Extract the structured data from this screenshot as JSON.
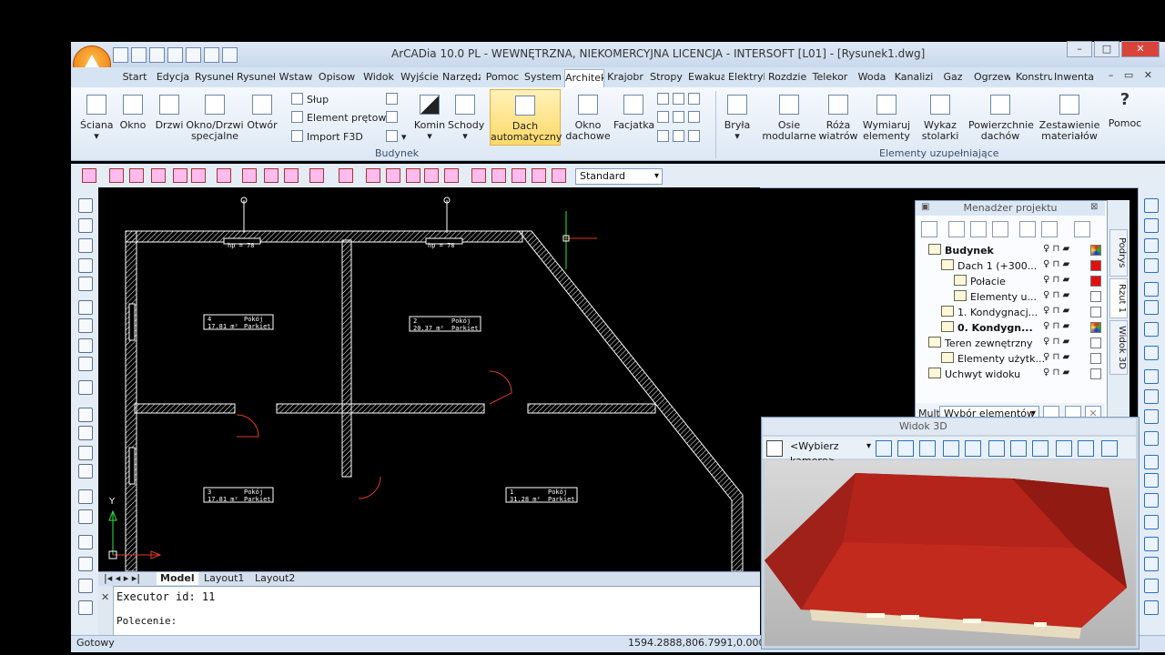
{
  "window": {
    "title": "ArCADia 10.0 PL - WEWNĘTRZNA, NIEKOMERCYJNA LICENCJA - INTERSOFT [L01] - [Rysunek1.dwg]"
  },
  "tabs": [
    "Start",
    "Edycja",
    "Rysuneł",
    "Rysuneł",
    "Wstaw",
    "Opisow",
    "Widok",
    "Wyjście",
    "Narzędz",
    "Pomoc",
    "System",
    "Architek",
    "Krajobr",
    "Stropy",
    "Ewakua",
    "Elektryk",
    "Rozdzie",
    "Telekor",
    "Woda",
    "Kanalizi",
    "Gaz",
    "Ogrzew",
    "Konstru",
    "Inwentaz"
  ],
  "tabs_active": "Architek",
  "ribbon": {
    "budynek_buttons": [
      "Ściana",
      "Okno",
      "Drzwi",
      "Okno/Drzwi\nspecjalne",
      "Otwór"
    ],
    "slup": "Słup",
    "element_pretowy": "Element prętowy",
    "import": "Import F3D",
    "komin": "Komin",
    "schody": "Schody",
    "dach": "Dach\nautomatyczny",
    "okno_dachowe": "Okno\ndachowe",
    "facjatka": "Facjatka",
    "group_budynek": "Budynek",
    "extra_buttons": [
      "Bryła",
      "Osie\nmodularne",
      "Róża\nwiatrów",
      "Wymiaruj\nelementy",
      "Wykaz\nstolarki",
      "Powierzchnie\ndachów",
      "Zestawienie\nmateriałów",
      "Pomoc"
    ],
    "group_extra": "Elementy uzupełniające"
  },
  "toolbar2": {
    "style_select": "Standard"
  },
  "drawing": {
    "rooms": [
      {
        "num": "4",
        "name": "Pokój",
        "area": "17.81 m²",
        "floor": "Parkiet"
      },
      {
        "num": "2",
        "name": "Pokój",
        "area": "20.37 m²",
        "floor": "Parkiet"
      },
      {
        "num": "3",
        "name": "Pokój",
        "area": "17.81 m²",
        "floor": "Parkiet"
      },
      {
        "num": "1",
        "name": "Pokój",
        "area": "31.28 m²",
        "floor": "Parkiet"
      }
    ],
    "window_label": "hp = 78",
    "y_axis": "Y"
  },
  "layout_tabs": [
    "Model",
    "Layout1",
    "Layout2"
  ],
  "command": {
    "line1": "Executor id: 11",
    "line2": "Polecenie:"
  },
  "status": {
    "left": "Gotowy",
    "coords": "1594.2888,806.7991,0.0000"
  },
  "project_manager": {
    "title": "Menadżer projektu",
    "tree": [
      {
        "label": "Budynek",
        "bold": true,
        "indent": 0,
        "flag": "multi"
      },
      {
        "label": "Dach 1 (+300...",
        "bold": false,
        "indent": 1,
        "flag": "red"
      },
      {
        "label": "Połacie",
        "bold": false,
        "indent": 2,
        "flag": "red"
      },
      {
        "label": "Elementy u...",
        "bold": false,
        "indent": 2,
        "flag": "white"
      },
      {
        "label": "1. Kondygnacj...",
        "bold": false,
        "indent": 1,
        "flag": "white"
      },
      {
        "label": "0. Kondygn...",
        "bold": true,
        "indent": 1,
        "flag": "multi"
      },
      {
        "label": "Teren zewnętrzny",
        "bold": false,
        "indent": 0,
        "flag": "white"
      },
      {
        "label": "Elementy użytk...",
        "bold": false,
        "indent": 1,
        "flag": "white"
      },
      {
        "label": "Uchwyt widoku",
        "bold": false,
        "indent": 0,
        "flag": "white"
      }
    ],
    "side_tabs": [
      "Podrys",
      "Rzut 1",
      "Widok 3D"
    ],
    "mult_label": "Mult",
    "select_label": "Wybór elementów"
  },
  "view3d": {
    "title": "Widok 3D",
    "camera_select": "<Wybierz kamerę>"
  }
}
